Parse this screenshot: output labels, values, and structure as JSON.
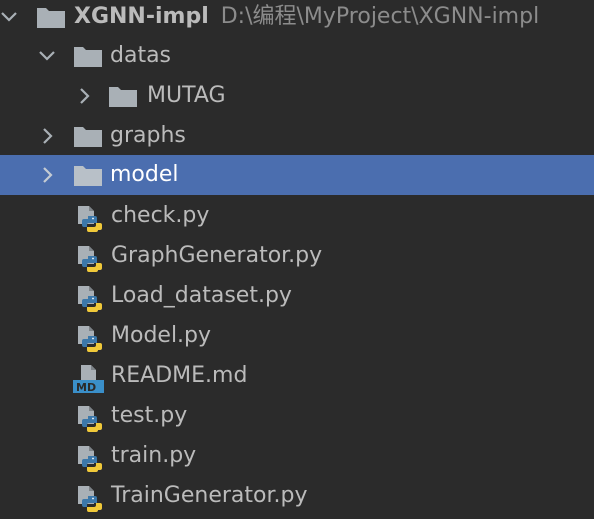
{
  "project": {
    "name": "XGNN-impl",
    "path": "D:\\编程\\MyProject\\XGNN-impl"
  },
  "tree": {
    "datas": "datas",
    "mutag": "MUTAG",
    "graphs": "graphs",
    "model": "model",
    "files": {
      "check": "check.py",
      "graph_generator": "GraphGenerator.py",
      "load_dataset": "Load_dataset.py",
      "model_py": "Model.py",
      "readme": "README.md",
      "test": "test.py",
      "train": "train.py",
      "train_generator": "TrainGenerator.py"
    }
  },
  "icons": {
    "folder": "folder-icon",
    "python": "python-file-icon",
    "markdown": "markdown-file-icon",
    "chevron_down": "chevron-down-icon",
    "chevron_right": "chevron-right-icon"
  },
  "colors": {
    "background": "#2b2b2b",
    "selection": "#4b6eaf",
    "text": "#bbbbbb",
    "path_text": "#8c8c8c",
    "folder": "#a9b0b6",
    "python_blue": "#3c78aa",
    "python_yellow": "#f0c93a",
    "md_badge": "#3a8fc9"
  }
}
